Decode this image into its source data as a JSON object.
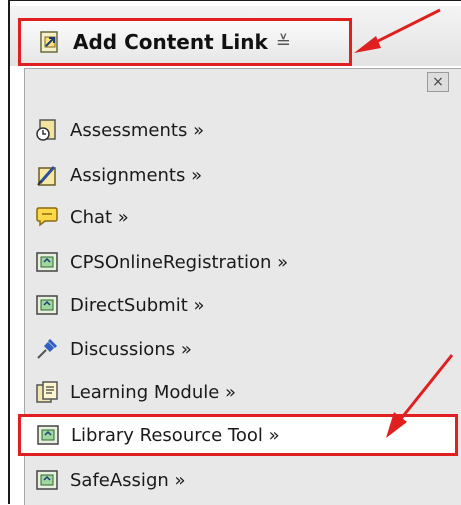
{
  "header": {
    "title": "Add Content Link",
    "chevron": "≚"
  },
  "menu": {
    "close_label": "×",
    "items": [
      {
        "label": "Assessments »",
        "icon": "assessment-icon"
      },
      {
        "label": "Assignments »",
        "icon": "assignment-icon"
      },
      {
        "label": "Chat »",
        "icon": "chat-icon"
      },
      {
        "label": "CPSOnlineRegistration »",
        "icon": "tool-icon"
      },
      {
        "label": "DirectSubmit »",
        "icon": "tool-icon"
      },
      {
        "label": "Discussions »",
        "icon": "pushpin-icon"
      },
      {
        "label": "Learning Module »",
        "icon": "learning-module-icon"
      },
      {
        "label": "Library Resource Tool »",
        "icon": "tool-icon",
        "highlighted": true
      },
      {
        "label": "SafeAssign »",
        "icon": "tool-icon"
      }
    ]
  },
  "colors": {
    "annotation": "#e02020",
    "panel": "#e8e8e8"
  }
}
